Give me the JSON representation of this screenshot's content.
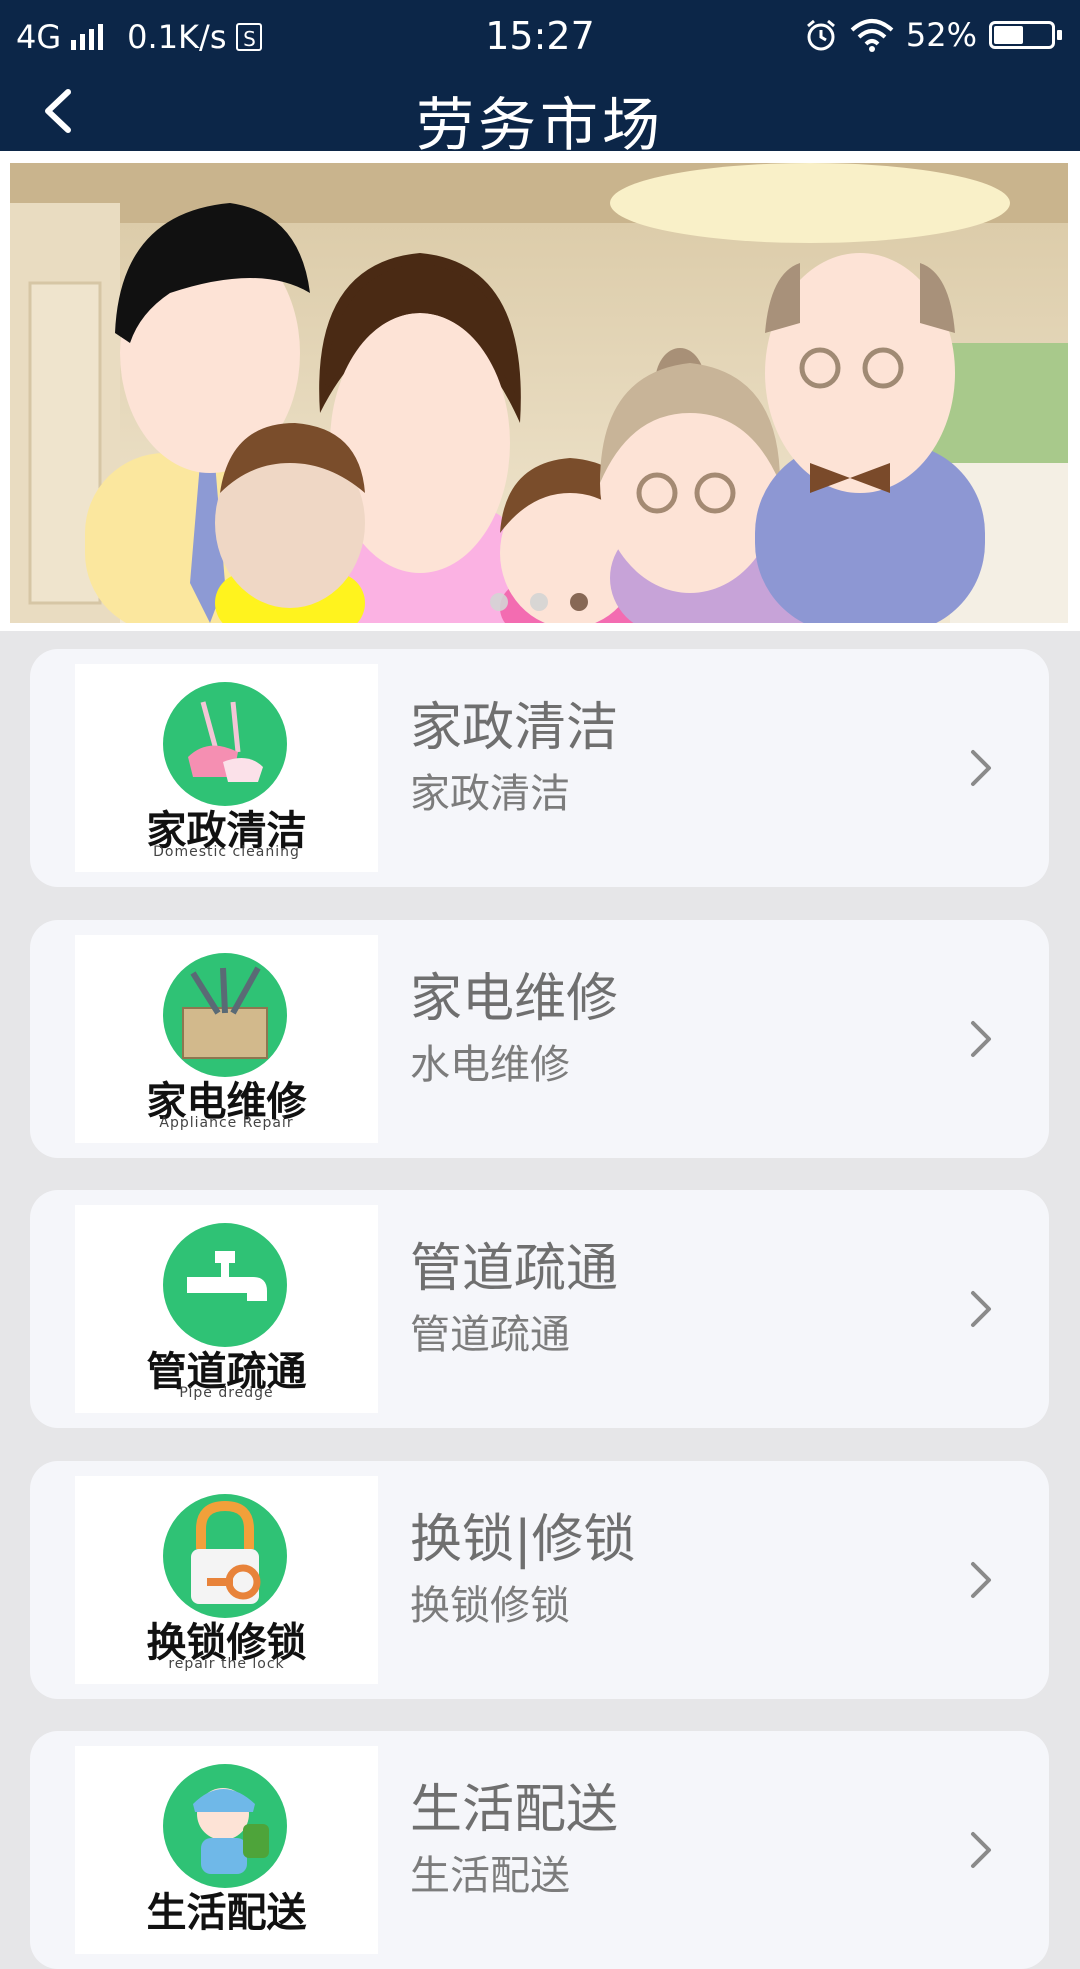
{
  "status_bar": {
    "network": "4G",
    "speed": "0.1K/s",
    "sim_icon": "S",
    "time": "15:27",
    "battery": "52%",
    "battery_level": 0.52,
    "icons": [
      "signal-icon",
      "sim-icon",
      "alarm-icon",
      "wifi-icon",
      "battery-icon"
    ]
  },
  "header": {
    "title": "劳务市场",
    "back_icon": "back-arrow-icon"
  },
  "banner": {
    "dots": 3,
    "active_dot": 2
  },
  "services": [
    {
      "title": "家政清洁",
      "subtitle": "家政清洁",
      "logo_text": "家政清洁",
      "logo_en": "Domestic   cleaning",
      "icon": "cleaning-icon"
    },
    {
      "title": "家电维修",
      "subtitle": "水电维修",
      "logo_text": "家电维修",
      "logo_en": "Appliance   Repair",
      "icon": "toolbox-icon"
    },
    {
      "title": "管道疏通",
      "subtitle": "管道疏通",
      "logo_text": "管道疏通",
      "logo_en": "Pipe dredge",
      "icon": "faucet-icon"
    },
    {
      "title": "换锁|修锁",
      "subtitle": "换锁修锁",
      "logo_text": "换锁修锁",
      "logo_en": "repair the lock",
      "icon": "lock-icon"
    },
    {
      "title": "生活配送",
      "subtitle": "生活配送",
      "logo_text": "生活配送",
      "logo_en": "",
      "icon": "delivery-icon"
    }
  ],
  "colors": {
    "header_bg": "#0c2648",
    "page_bg": "#e6e6e8",
    "card_bg": "#f5f6fa",
    "logo_green": "#2fc275"
  }
}
